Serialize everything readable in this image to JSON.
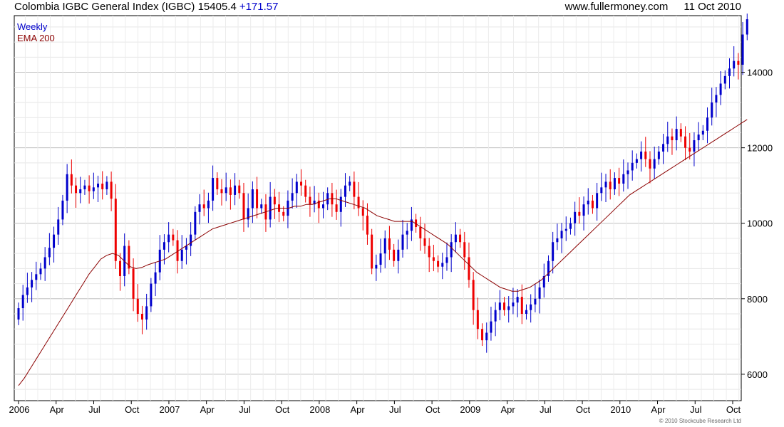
{
  "header": {
    "title": "Colombia IGBC General Index (IGBC) 15405.4",
    "change": "+171.57",
    "website": "www.fullermoney.com",
    "date": "11 Oct 2010"
  },
  "legend": {
    "line1": "Weekly",
    "line2": "EMA 200"
  },
  "copyright": "© 2010 Stockcube Research Ltd",
  "colors": {
    "up": "#0000cc",
    "down": "#ee0000",
    "ema": "#8b0000",
    "grid": "#d8d8d8",
    "frame": "#000000"
  },
  "chart_data": {
    "type": "candlestick",
    "x_tick_labels": [
      "2006",
      "Apr",
      "Jul",
      "Oct",
      "2007",
      "Apr",
      "Jul",
      "Oct",
      "2008",
      "Apr",
      "Jul",
      "Oct",
      "2009",
      "Apr",
      "Jul",
      "Oct",
      "2010",
      "Apr",
      "Jul",
      "Oct"
    ],
    "y_ticks": [
      6000,
      8000,
      10000,
      12000,
      14000
    ],
    "ylim": [
      5300,
      15500
    ],
    "week_range": [
      0,
      252
    ],
    "x_tick_weeks": [
      0,
      13,
      26,
      39,
      52,
      65,
      78,
      91,
      104,
      117,
      130,
      143,
      156,
      169,
      182,
      195,
      208,
      221,
      234,
      247
    ],
    "series": [
      {
        "name": "Weekly",
        "closes_weekly": [
          7750,
          8100,
          8300,
          8500,
          8650,
          8800,
          9100,
          9350,
          9700,
          10100,
          10600,
          11300,
          11000,
          10800,
          10900,
          11000,
          10850,
          10950,
          11050,
          10900,
          11100,
          10650,
          9000,
          8600,
          9400,
          8800,
          8000,
          7600,
          7450,
          7800,
          8400,
          8700,
          9300,
          9500,
          9700,
          9550,
          9000,
          9300,
          9400,
          9700,
          10300,
          10500,
          10400,
          10600,
          11200,
          10900,
          10800,
          10950,
          10750,
          11000,
          10800,
          10100,
          10400,
          10900,
          10400,
          10500,
          10100,
          10700,
          10500,
          10300,
          10200,
          10600,
          10800,
          11100,
          11000,
          10700,
          10500,
          10600,
          10400,
          10500,
          10800,
          10500,
          10300,
          10700,
          11000,
          11100,
          10700,
          10400,
          10200,
          9700,
          8800,
          8900,
          9200,
          9600,
          9300,
          9000,
          9300,
          9700,
          9800,
          10100,
          9900,
          9600,
          9400,
          9100,
          9000,
          8850,
          8950,
          9100,
          9500,
          9700,
          9500,
          9100,
          8500,
          7700,
          7200,
          6900,
          7100,
          7400,
          7700,
          7900,
          7700,
          7800,
          7900,
          8050,
          7600,
          7700,
          7850,
          8000,
          8300,
          8600,
          9000,
          9500,
          9600,
          9800,
          9850,
          10000,
          10300,
          10200,
          10500,
          10600,
          10400,
          10800,
          10950,
          11100,
          10900,
          11200,
          11050,
          11300,
          11400,
          11600,
          11700,
          11900,
          11700,
          11450,
          11700,
          11900,
          12100,
          12300,
          12200,
          12500,
          12300,
          12000,
          11900,
          12200,
          12350,
          12450,
          12800,
          13200,
          13400,
          13700,
          13900,
          14100,
          14300,
          14200,
          15000,
          15405
        ],
        "note": "Weekly closes resampled to 160 points spanning week_range; each renders as an OHLC candle coloured up/down."
      },
      {
        "name": "EMA 200",
        "values_weekly": [
          5700,
          5900,
          6150,
          6400,
          6650,
          6900,
          7150,
          7400,
          7650,
          7900,
          8150,
          8400,
          8650,
          8850,
          9050,
          9150,
          9200,
          9150,
          9000,
          8850,
          8800,
          8830,
          8900,
          8950,
          9000,
          9050,
          9150,
          9250,
          9350,
          9450,
          9550,
          9650,
          9750,
          9850,
          9900,
          9950,
          10000,
          10050,
          10100,
          10150,
          10200,
          10250,
          10300,
          10350,
          10400,
          10400,
          10400,
          10450,
          10450,
          10500,
          10500,
          10550,
          10600,
          10650,
          10650,
          10600,
          10550,
          10500,
          10450,
          10400,
          10300,
          10200,
          10150,
          10100,
          10050,
          10050,
          10050,
          10050,
          9950,
          9850,
          9750,
          9650,
          9550,
          9450,
          9300,
          9150,
          9000,
          8850,
          8700,
          8600,
          8500,
          8400,
          8300,
          8250,
          8200,
          8200,
          8250,
          8300,
          8400,
          8500,
          8650,
          8800,
          8950,
          9100,
          9250,
          9400,
          9550,
          9700,
          9850,
          10000,
          10150,
          10300,
          10450,
          10600,
          10750,
          10850,
          10950,
          11050,
          11150,
          11250,
          11350,
          11450,
          11550,
          11650,
          11750,
          11850,
          11950,
          12050,
          12150,
          12250,
          12350,
          12450,
          12550,
          12650,
          12750
        ],
        "note": "Values resampled across week_range."
      }
    ]
  }
}
